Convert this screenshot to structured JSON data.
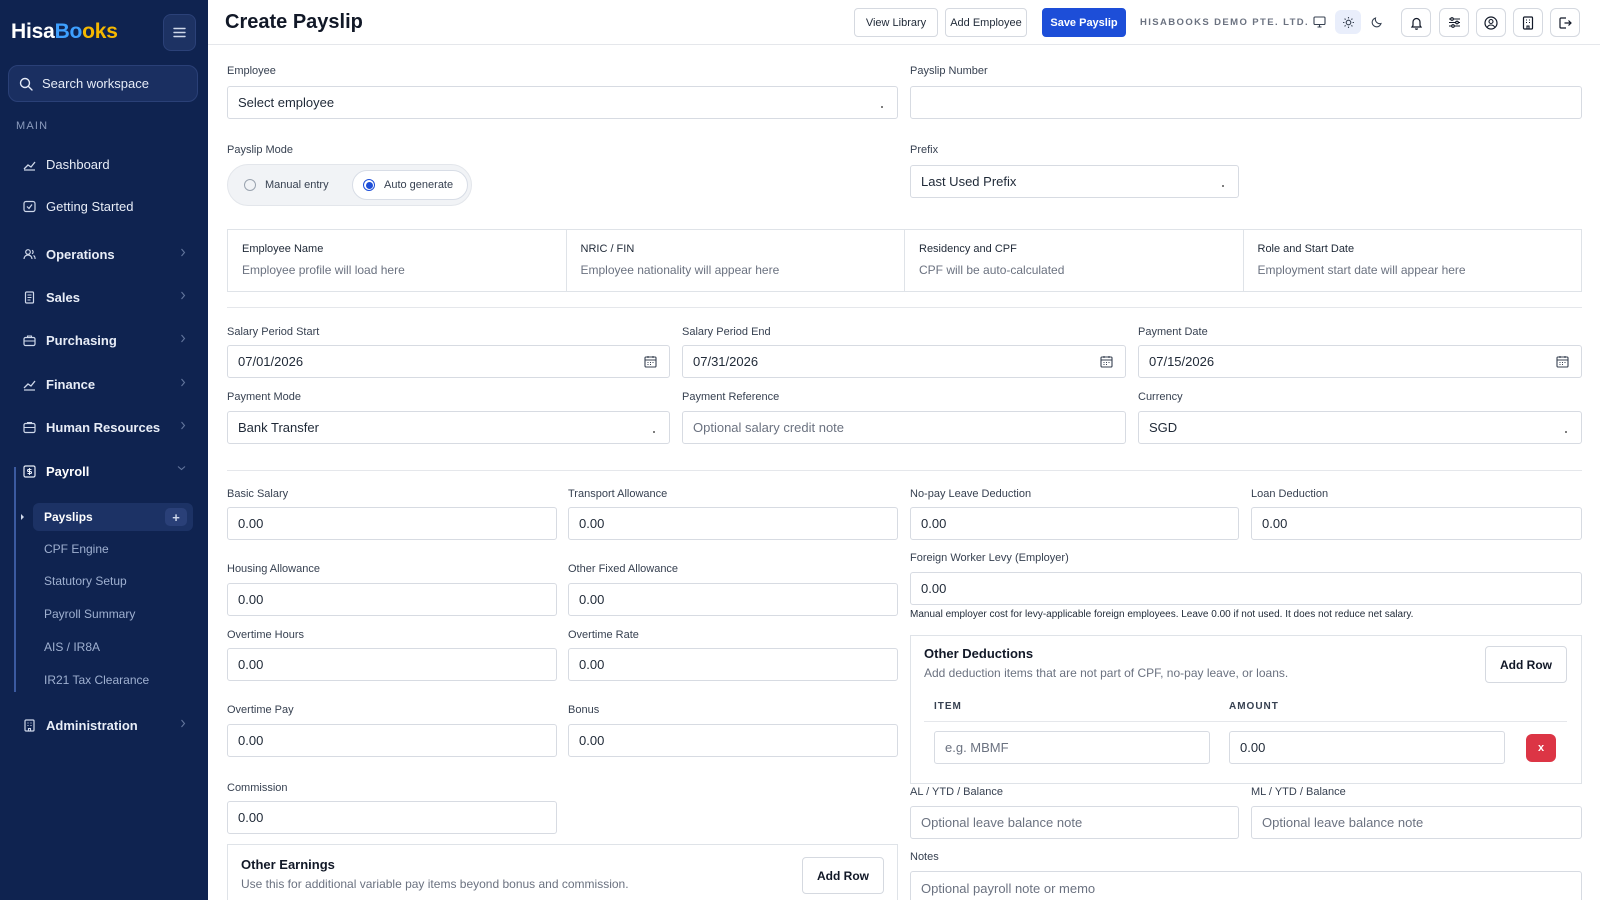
{
  "brand": {
    "part1": "Hisa",
    "part2": "Bo",
    "part3": "oks"
  },
  "sidebar": {
    "search_label": "Search workspace",
    "section_main": "MAIN",
    "items": {
      "dashboard": "Dashboard",
      "getting_started": "Getting Started",
      "operations": "Operations",
      "sales": "Sales",
      "purchasing": "Purchasing",
      "finance": "Finance",
      "human_resources": "Human Resources",
      "payroll": "Payroll",
      "administration": "Administration"
    },
    "payroll_sub": [
      "Payslips",
      "CPF Engine",
      "Statutory Setup",
      "Payroll Summary",
      "AIS / IR8A",
      "IR21 Tax Clearance"
    ],
    "add_icon": "+"
  },
  "header": {
    "title": "Create Payslip",
    "view_library": "View Library",
    "add_employee": "Add Employee",
    "save_payslip": "Save Payslip",
    "company": "HISABOOKS DEMO PTE. LTD."
  },
  "form": {
    "employee": {
      "label": "Employee",
      "value": "Select employee"
    },
    "payslip_number": {
      "label": "Payslip Number",
      "value": ""
    },
    "mode": {
      "label": "Payslip Mode",
      "manual": "Manual entry",
      "auto": "Auto generate",
      "selected": "auto"
    },
    "prefix": {
      "label": "Prefix",
      "value": "Last Used Prefix"
    },
    "info": [
      {
        "title": "Employee Name",
        "value": "Employee profile will load here"
      },
      {
        "title": "NRIC / FIN",
        "value": "Employee nationality will appear here"
      },
      {
        "title": "Residency and CPF",
        "value": "CPF will be auto-calculated"
      },
      {
        "title": "Role and Start Date",
        "value": "Employment start date will appear here"
      }
    ],
    "period_start": {
      "label": "Salary Period Start",
      "value": "07/01/2026"
    },
    "period_end": {
      "label": "Salary Period End",
      "value": "07/31/2026"
    },
    "payment_date": {
      "label": "Payment Date",
      "value": "07/15/2026"
    },
    "payment_mode": {
      "label": "Payment Mode",
      "value": "Bank Transfer"
    },
    "payment_reference": {
      "label": "Payment Reference",
      "placeholder": "Optional salary credit note"
    },
    "currency": {
      "label": "Currency",
      "value": "SGD"
    },
    "basic_salary": {
      "label": "Basic Salary",
      "value": "0.00"
    },
    "transport_allowance": {
      "label": "Transport Allowance",
      "value": "0.00"
    },
    "housing_allowance": {
      "label": "Housing Allowance",
      "value": "0.00"
    },
    "other_fixed_allowance": {
      "label": "Other Fixed Allowance",
      "value": "0.00"
    },
    "overtime_hours": {
      "label": "Overtime Hours",
      "value": "0.00"
    },
    "overtime_rate": {
      "label": "Overtime Rate",
      "value": "0.00"
    },
    "overtime_pay": {
      "label": "Overtime Pay",
      "value": "0.00"
    },
    "bonus": {
      "label": "Bonus",
      "value": "0.00"
    },
    "commission": {
      "label": "Commission",
      "value": "0.00"
    },
    "other_earnings": {
      "title": "Other Earnings",
      "subtitle": "Use this for additional variable pay items beyond bonus and commission.",
      "add_row": "Add Row"
    },
    "nopay_deduction": {
      "label": "No-pay Leave Deduction",
      "value": "0.00"
    },
    "loan_deduction": {
      "label": "Loan Deduction",
      "value": "0.00"
    },
    "fwl": {
      "label": "Foreign Worker Levy (Employer)",
      "value": "0.00",
      "helper": "Manual employer cost for levy-applicable foreign employees. Leave 0.00 if not used. It does not reduce net salary."
    },
    "other_deductions": {
      "title": "Other Deductions",
      "subtitle": "Add deduction items that are not part of CPF, no-pay leave, or loans.",
      "add_row": "Add Row",
      "col_item": "ITEM",
      "col_amount": "AMOUNT",
      "row_item_placeholder": "e.g. MBMF",
      "row_amount": "0.00",
      "remove": "x"
    },
    "al_balance": {
      "label": "AL / YTD / Balance",
      "placeholder": "Optional leave balance note"
    },
    "ml_balance": {
      "label": "ML / YTD / Balance",
      "placeholder": "Optional leave balance note"
    },
    "notes": {
      "label": "Notes",
      "placeholder": "Optional payroll note or memo"
    }
  }
}
